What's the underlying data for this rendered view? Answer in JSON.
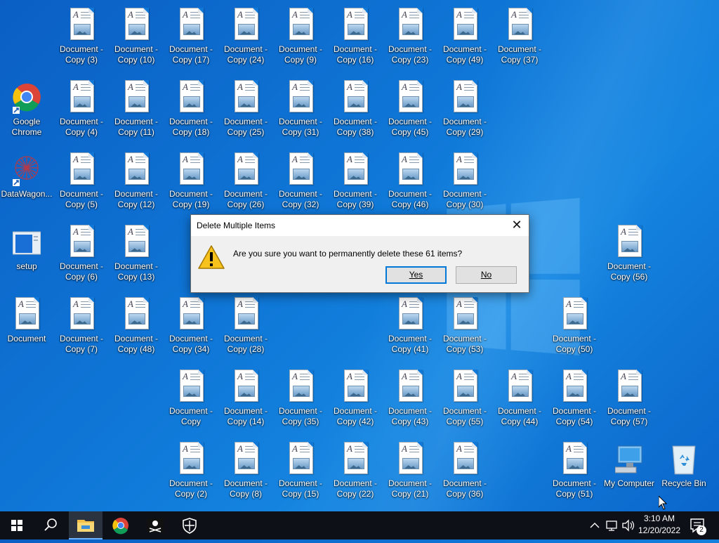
{
  "dialog": {
    "title": "Delete Multiple Items",
    "close_label": "✕",
    "message": "Are you sure you want to permanently delete these 61 items?",
    "yes_label": "Yes",
    "no_label": "No"
  },
  "icons": {
    "chrome": "Google Chrome",
    "datawagon": "DataWagon...",
    "setup": "setup",
    "document": "Document",
    "my_computer": "My Computer",
    "recycle_bin": "Recycle Bin",
    "c3": "Document - Copy (3)",
    "c10": "Document - Copy (10)",
    "c17": "Document - Copy (17)",
    "c24": "Document - Copy (24)",
    "c9": "Document - Copy (9)",
    "c16": "Document - Copy (16)",
    "c23": "Document - Copy (23)",
    "c49": "Document - Copy (49)",
    "c37": "Document - Copy (37)",
    "c4": "Document - Copy (4)",
    "c11": "Document - Copy (11)",
    "c18": "Document - Copy (18)",
    "c25": "Document - Copy (25)",
    "c31": "Document - Copy (31)",
    "c38": "Document - Copy (38)",
    "c45": "Document - Copy (45)",
    "c29": "Document - Copy (29)",
    "c5": "Document - Copy (5)",
    "c12": "Document - Copy (12)",
    "c19": "Document - Copy (19)",
    "c26": "Document - Copy (26)",
    "c32": "Document - Copy (32)",
    "c39": "Document - Copy (39)",
    "c46": "Document - Copy (46)",
    "c30": "Document - Copy (30)",
    "c6": "Document - Copy (6)",
    "c13": "Document - Copy (13)",
    "c56": "Document - Copy (56)",
    "c7": "Document - Copy (7)",
    "c48": "Document - Copy (48)",
    "c34": "Document - Copy (34)",
    "c28": "Document - Copy (28)",
    "c41": "Document - Copy (41)",
    "c53": "Document - Copy (53)",
    "c50": "Document - Copy (50)",
    "c0": "Document - Copy",
    "c14": "Document - Copy (14)",
    "c35": "Document - Copy (35)",
    "c42": "Document - Copy (42)",
    "c43": "Document - Copy (43)",
    "c55": "Document - Copy (55)",
    "c44": "Document - Copy (44)",
    "c54": "Document - Copy (54)",
    "c57": "Document - Copy (57)",
    "c2": "Document - Copy (2)",
    "c8": "Document - Copy (8)",
    "c15": "Document - Copy (15)",
    "c22": "Document - Copy (22)",
    "c21": "Document - Copy (21)",
    "c36": "Document - Copy (36)",
    "c51": "Document - Copy (51)"
  },
  "taskbar": {
    "time": "3:10 AM",
    "date": "12/20/2022",
    "notification_count": "2",
    "apps": [
      "start-icon",
      "search-icon",
      "file-explorer-icon",
      "chrome-icon",
      "pirate-flag-icon",
      "security-shield-icon"
    ],
    "active_app": "file-explorer-icon"
  },
  "colors": {
    "desktop_bg": "#0f78d8",
    "taskbar_bg": "#0d1117",
    "dialog_bg": "#f0f0f0",
    "accent": "#0078d7"
  }
}
